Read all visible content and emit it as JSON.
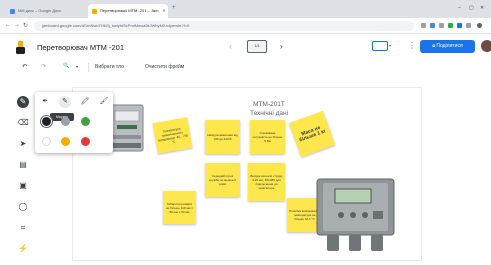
{
  "browser": {
    "tabs": [
      {
        "label": "Мій диск – Google Диск",
        "favicon_color": "#4285f4"
      },
      {
        "label": "Перетворювач МТМ -201 – Jam",
        "favicon_color": "#f9ab00"
      }
    ],
    "new_tab": "+",
    "address": "jamboard.google.com/d/1mNwuTHkGj_kwlyhtSxPmiMwua5kJWbyMXn4ymwie?f=0"
  },
  "app": {
    "document_title": "Перетворювач МТМ -201",
    "frame_label": "1/1",
    "share_label": "Поділитися",
    "accent_color": "#1a73e8"
  },
  "toolbar": {
    "undo": "↶",
    "redo": "↷",
    "zoom": "🔍",
    "zoom_caret": "▾",
    "set_background": "Вибрати тло",
    "clear_frame": "Очистити фрейм"
  },
  "board": {
    "title": "МТМ-201Т",
    "subtitle": "Технічні дані",
    "notes": [
      {
        "text": "Температура навколишнього середовища -40…+50 °С"
      },
      {
        "text": "Напруга живлення від 100 до 240 В"
      },
      {
        "text": "Споживана потужність не більше 5 ВА"
      },
      {
        "text": "Маса не більше 1 кг"
      },
      {
        "text": "Середній строк служби не менше 8 років"
      },
      {
        "text": "Вихідні сигнали струму 4-20 мА, RS-485 для підключення до комп'ютера"
      },
      {
        "text": "Габаритні розміри не більше 110 мм × 80 мм × 50 мм"
      },
      {
        "text": "Похибка вимірювання температури не більше ±0,5 °С"
      }
    ]
  },
  "pen_popup": {
    "tooltip": "Маркер",
    "colors": [
      "#202124",
      "#9aa0a6",
      "#1e88e5",
      "#43a047",
      "#ffffff",
      "#f9ab00",
      "#e53935"
    ]
  }
}
